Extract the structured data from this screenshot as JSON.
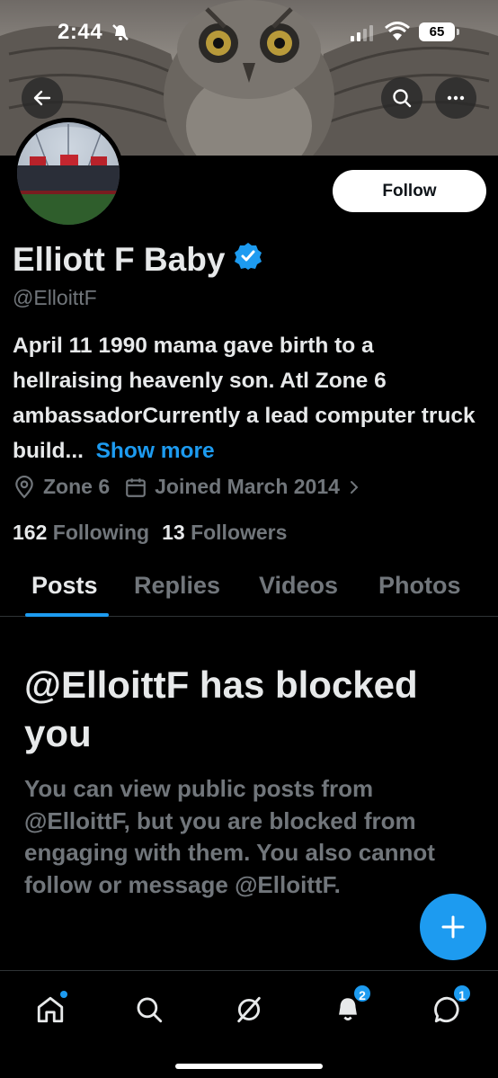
{
  "status_bar": {
    "time": "2:44",
    "battery": "65"
  },
  "profile": {
    "display_name": "Elliott F Baby",
    "handle": "@ElloittF",
    "bio": "April 11 1990 mama gave birth to a hellraising heavenly son. Atl Zone 6 ambassadorCurrently a lead computer truck build...",
    "bio_more": "Show more",
    "location": "Zone 6",
    "joined": "Joined March 2014",
    "following_count": "162",
    "following_label": "Following",
    "followers_count": "13",
    "followers_label": "Followers",
    "follow_button": "Follow"
  },
  "tabs": [
    "Posts",
    "Replies",
    "Videos",
    "Photos"
  ],
  "blocked": {
    "title": "@ElloittF has blocked you",
    "body": "You can view public posts from @ElloittF, but you are blocked from engaging with them. You also cannot follow or message @ElloittF."
  },
  "bottom_nav": {
    "notifications_badge": "2",
    "messages_badge": "1"
  },
  "colors": {
    "accent": "#1d9bf0",
    "background": "#000000",
    "muted": "#71767b",
    "text": "#e7e9ea"
  }
}
